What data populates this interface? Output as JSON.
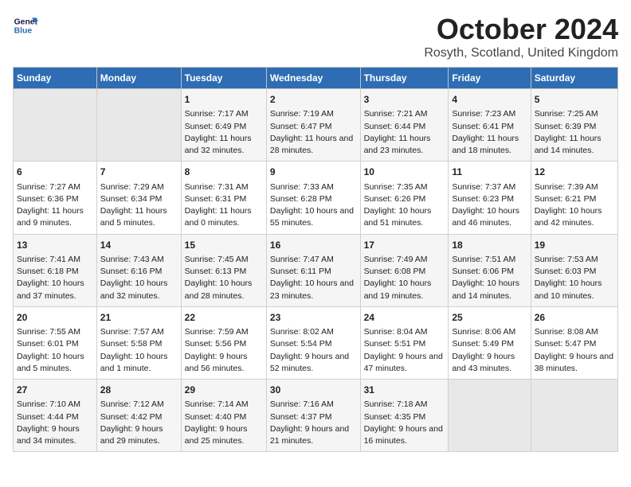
{
  "logo": {
    "line1": "General",
    "line2": "Blue"
  },
  "title": "October 2024",
  "location": "Rosyth, Scotland, United Kingdom",
  "headers": [
    "Sunday",
    "Monday",
    "Tuesday",
    "Wednesday",
    "Thursday",
    "Friday",
    "Saturday"
  ],
  "weeks": [
    [
      {
        "day": "",
        "sunrise": "",
        "sunset": "",
        "daylight": ""
      },
      {
        "day": "",
        "sunrise": "",
        "sunset": "",
        "daylight": ""
      },
      {
        "day": "1",
        "sunrise": "Sunrise: 7:17 AM",
        "sunset": "Sunset: 6:49 PM",
        "daylight": "Daylight: 11 hours and 32 minutes."
      },
      {
        "day": "2",
        "sunrise": "Sunrise: 7:19 AM",
        "sunset": "Sunset: 6:47 PM",
        "daylight": "Daylight: 11 hours and 28 minutes."
      },
      {
        "day": "3",
        "sunrise": "Sunrise: 7:21 AM",
        "sunset": "Sunset: 6:44 PM",
        "daylight": "Daylight: 11 hours and 23 minutes."
      },
      {
        "day": "4",
        "sunrise": "Sunrise: 7:23 AM",
        "sunset": "Sunset: 6:41 PM",
        "daylight": "Daylight: 11 hours and 18 minutes."
      },
      {
        "day": "5",
        "sunrise": "Sunrise: 7:25 AM",
        "sunset": "Sunset: 6:39 PM",
        "daylight": "Daylight: 11 hours and 14 minutes."
      }
    ],
    [
      {
        "day": "6",
        "sunrise": "Sunrise: 7:27 AM",
        "sunset": "Sunset: 6:36 PM",
        "daylight": "Daylight: 11 hours and 9 minutes."
      },
      {
        "day": "7",
        "sunrise": "Sunrise: 7:29 AM",
        "sunset": "Sunset: 6:34 PM",
        "daylight": "Daylight: 11 hours and 5 minutes."
      },
      {
        "day": "8",
        "sunrise": "Sunrise: 7:31 AM",
        "sunset": "Sunset: 6:31 PM",
        "daylight": "Daylight: 11 hours and 0 minutes."
      },
      {
        "day": "9",
        "sunrise": "Sunrise: 7:33 AM",
        "sunset": "Sunset: 6:28 PM",
        "daylight": "Daylight: 10 hours and 55 minutes."
      },
      {
        "day": "10",
        "sunrise": "Sunrise: 7:35 AM",
        "sunset": "Sunset: 6:26 PM",
        "daylight": "Daylight: 10 hours and 51 minutes."
      },
      {
        "day": "11",
        "sunrise": "Sunrise: 7:37 AM",
        "sunset": "Sunset: 6:23 PM",
        "daylight": "Daylight: 10 hours and 46 minutes."
      },
      {
        "day": "12",
        "sunrise": "Sunrise: 7:39 AM",
        "sunset": "Sunset: 6:21 PM",
        "daylight": "Daylight: 10 hours and 42 minutes."
      }
    ],
    [
      {
        "day": "13",
        "sunrise": "Sunrise: 7:41 AM",
        "sunset": "Sunset: 6:18 PM",
        "daylight": "Daylight: 10 hours and 37 minutes."
      },
      {
        "day": "14",
        "sunrise": "Sunrise: 7:43 AM",
        "sunset": "Sunset: 6:16 PM",
        "daylight": "Daylight: 10 hours and 32 minutes."
      },
      {
        "day": "15",
        "sunrise": "Sunrise: 7:45 AM",
        "sunset": "Sunset: 6:13 PM",
        "daylight": "Daylight: 10 hours and 28 minutes."
      },
      {
        "day": "16",
        "sunrise": "Sunrise: 7:47 AM",
        "sunset": "Sunset: 6:11 PM",
        "daylight": "Daylight: 10 hours and 23 minutes."
      },
      {
        "day": "17",
        "sunrise": "Sunrise: 7:49 AM",
        "sunset": "Sunset: 6:08 PM",
        "daylight": "Daylight: 10 hours and 19 minutes."
      },
      {
        "day": "18",
        "sunrise": "Sunrise: 7:51 AM",
        "sunset": "Sunset: 6:06 PM",
        "daylight": "Daylight: 10 hours and 14 minutes."
      },
      {
        "day": "19",
        "sunrise": "Sunrise: 7:53 AM",
        "sunset": "Sunset: 6:03 PM",
        "daylight": "Daylight: 10 hours and 10 minutes."
      }
    ],
    [
      {
        "day": "20",
        "sunrise": "Sunrise: 7:55 AM",
        "sunset": "Sunset: 6:01 PM",
        "daylight": "Daylight: 10 hours and 5 minutes."
      },
      {
        "day": "21",
        "sunrise": "Sunrise: 7:57 AM",
        "sunset": "Sunset: 5:58 PM",
        "daylight": "Daylight: 10 hours and 1 minute."
      },
      {
        "day": "22",
        "sunrise": "Sunrise: 7:59 AM",
        "sunset": "Sunset: 5:56 PM",
        "daylight": "Daylight: 9 hours and 56 minutes."
      },
      {
        "day": "23",
        "sunrise": "Sunrise: 8:02 AM",
        "sunset": "Sunset: 5:54 PM",
        "daylight": "Daylight: 9 hours and 52 minutes."
      },
      {
        "day": "24",
        "sunrise": "Sunrise: 8:04 AM",
        "sunset": "Sunset: 5:51 PM",
        "daylight": "Daylight: 9 hours and 47 minutes."
      },
      {
        "day": "25",
        "sunrise": "Sunrise: 8:06 AM",
        "sunset": "Sunset: 5:49 PM",
        "daylight": "Daylight: 9 hours and 43 minutes."
      },
      {
        "day": "26",
        "sunrise": "Sunrise: 8:08 AM",
        "sunset": "Sunset: 5:47 PM",
        "daylight": "Daylight: 9 hours and 38 minutes."
      }
    ],
    [
      {
        "day": "27",
        "sunrise": "Sunrise: 7:10 AM",
        "sunset": "Sunset: 4:44 PM",
        "daylight": "Daylight: 9 hours and 34 minutes."
      },
      {
        "day": "28",
        "sunrise": "Sunrise: 7:12 AM",
        "sunset": "Sunset: 4:42 PM",
        "daylight": "Daylight: 9 hours and 29 minutes."
      },
      {
        "day": "29",
        "sunrise": "Sunrise: 7:14 AM",
        "sunset": "Sunset: 4:40 PM",
        "daylight": "Daylight: 9 hours and 25 minutes."
      },
      {
        "day": "30",
        "sunrise": "Sunrise: 7:16 AM",
        "sunset": "Sunset: 4:37 PM",
        "daylight": "Daylight: 9 hours and 21 minutes."
      },
      {
        "day": "31",
        "sunrise": "Sunrise: 7:18 AM",
        "sunset": "Sunset: 4:35 PM",
        "daylight": "Daylight: 9 hours and 16 minutes."
      },
      {
        "day": "",
        "sunrise": "",
        "sunset": "",
        "daylight": ""
      },
      {
        "day": "",
        "sunrise": "",
        "sunset": "",
        "daylight": ""
      }
    ]
  ]
}
